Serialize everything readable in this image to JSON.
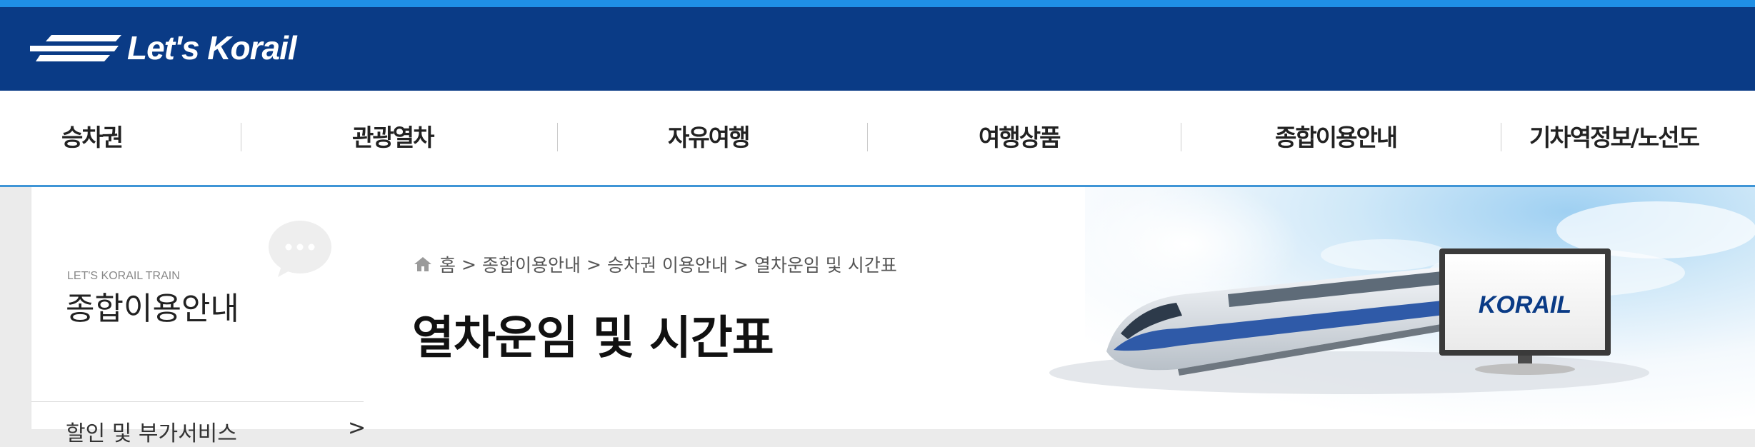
{
  "brand": {
    "logo_text": "Let's Korail",
    "header_color": "#0a3b86",
    "accent_color": "#1f8fe6"
  },
  "nav": {
    "items": [
      {
        "label": "승차권"
      },
      {
        "label": "관광열차"
      },
      {
        "label": "자유여행"
      },
      {
        "label": "여행상품"
      },
      {
        "label": "종합이용안내"
      },
      {
        "label": "기차역정보/노선도"
      }
    ]
  },
  "sidebar": {
    "eyebrow": "LET'S KORAIL TRAIN",
    "title": "종합이용안내",
    "menu_first": "할인 및 부가서비스",
    "menu_arrow": ">",
    "icon": "chat-bubble-icon"
  },
  "breadcrumb": {
    "home_icon": "home-icon",
    "home": "홈",
    "sep": ">",
    "level1": "종합이용안내",
    "level2": "승차권 이용안내",
    "level3": "열차운임 및 시간표"
  },
  "page": {
    "title": "열차운임 및 시간표"
  },
  "hero": {
    "monitor_logo": "KORAIL"
  }
}
